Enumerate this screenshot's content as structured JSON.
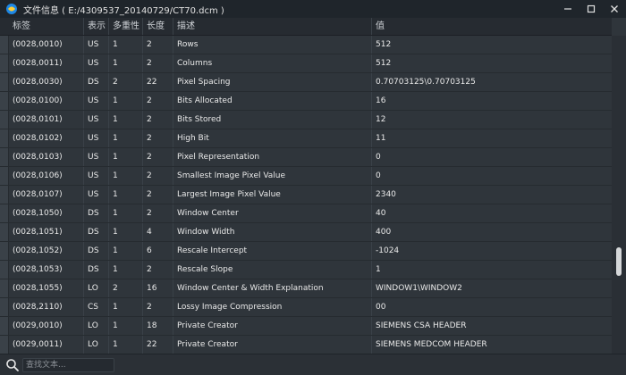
{
  "titlebar": {
    "title": "文件信息 ( E:/4309537_20140729/CT70.dcm )",
    "min_icon": "minimize-icon",
    "max_icon": "maximize-icon",
    "close_icon": "close-icon"
  },
  "table": {
    "headers": [
      "标签",
      "表示",
      "多重性",
      "长度",
      "描述",
      "值"
    ],
    "rows": [
      {
        "tag": "(0028,0010)",
        "vr": "US",
        "vm": "1",
        "len": "2",
        "desc": "Rows",
        "val": "512"
      },
      {
        "tag": "(0028,0011)",
        "vr": "US",
        "vm": "1",
        "len": "2",
        "desc": "Columns",
        "val": "512"
      },
      {
        "tag": "(0028,0030)",
        "vr": "DS",
        "vm": "2",
        "len": "22",
        "desc": "Pixel Spacing",
        "val": "0.70703125\\0.70703125"
      },
      {
        "tag": "(0028,0100)",
        "vr": "US",
        "vm": "1",
        "len": "2",
        "desc": "Bits Allocated",
        "val": "16"
      },
      {
        "tag": "(0028,0101)",
        "vr": "US",
        "vm": "1",
        "len": "2",
        "desc": "Bits Stored",
        "val": "12"
      },
      {
        "tag": "(0028,0102)",
        "vr": "US",
        "vm": "1",
        "len": "2",
        "desc": "High Bit",
        "val": "11"
      },
      {
        "tag": "(0028,0103)",
        "vr": "US",
        "vm": "1",
        "len": "2",
        "desc": "Pixel Representation",
        "val": "0"
      },
      {
        "tag": "(0028,0106)",
        "vr": "US",
        "vm": "1",
        "len": "2",
        "desc": "Smallest Image Pixel Value",
        "val": "0"
      },
      {
        "tag": "(0028,0107)",
        "vr": "US",
        "vm": "1",
        "len": "2",
        "desc": "Largest Image Pixel Value",
        "val": "2340"
      },
      {
        "tag": "(0028,1050)",
        "vr": "DS",
        "vm": "1",
        "len": "2",
        "desc": "Window Center",
        "val": "40"
      },
      {
        "tag": "(0028,1051)",
        "vr": "DS",
        "vm": "1",
        "len": "4",
        "desc": "Window Width",
        "val": "400"
      },
      {
        "tag": "(0028,1052)",
        "vr": "DS",
        "vm": "1",
        "len": "6",
        "desc": "Rescale Intercept",
        "val": "-1024"
      },
      {
        "tag": "(0028,1053)",
        "vr": "DS",
        "vm": "1",
        "len": "2",
        "desc": "Rescale Slope",
        "val": "1"
      },
      {
        "tag": "(0028,1055)",
        "vr": "LO",
        "vm": "2",
        "len": "16",
        "desc": "Window Center & Width Explanation",
        "val": "WINDOW1\\WINDOW2"
      },
      {
        "tag": "(0028,2110)",
        "vr": "CS",
        "vm": "1",
        "len": "2",
        "desc": "Lossy Image Compression",
        "val": "00"
      },
      {
        "tag": "(0029,0010)",
        "vr": "LO",
        "vm": "1",
        "len": "18",
        "desc": "Private Creator",
        "val": "SIEMENS CSA HEADER"
      },
      {
        "tag": "(0029,0011)",
        "vr": "LO",
        "vm": "1",
        "len": "22",
        "desc": "Private Creator",
        "val": "SIEMENS MEDCOM HEADER"
      }
    ]
  },
  "search": {
    "placeholder": "查找文本...",
    "value": ""
  },
  "colors": {
    "background": "#2f353b",
    "titlebar": "#1f252b",
    "header": "#262b31",
    "text": "#e9e9e9"
  }
}
